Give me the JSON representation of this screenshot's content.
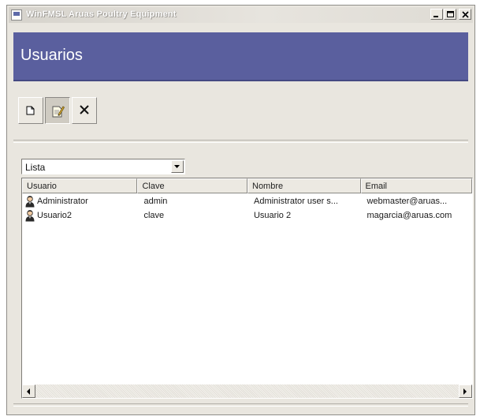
{
  "window": {
    "title": "WinFMSL Aruas Poultry Equipment"
  },
  "header": {
    "title": "Usuarios"
  },
  "colors": {
    "banner": "#5a5f9e",
    "window_bg": "#e9e6df"
  },
  "toolbar": {
    "buttons": [
      {
        "name": "new-button",
        "icon": "new-document-icon"
      },
      {
        "name": "edit-button",
        "icon": "edit-document-icon",
        "pressed": true
      },
      {
        "name": "delete-button",
        "icon": "delete-x-icon"
      }
    ]
  },
  "view_select": {
    "value": "Lista"
  },
  "list": {
    "columns": [
      "Usuario",
      "Clave",
      "Nombre",
      "Email"
    ],
    "rows": [
      {
        "usuario": "Administrator",
        "clave": "admin",
        "nombre": "Administrator user s...",
        "email": "webmaster@aruas..."
      },
      {
        "usuario": "Usuario2",
        "clave": "clave",
        "nombre": "Usuario 2",
        "email": "magarcia@aruas.com"
      }
    ]
  }
}
